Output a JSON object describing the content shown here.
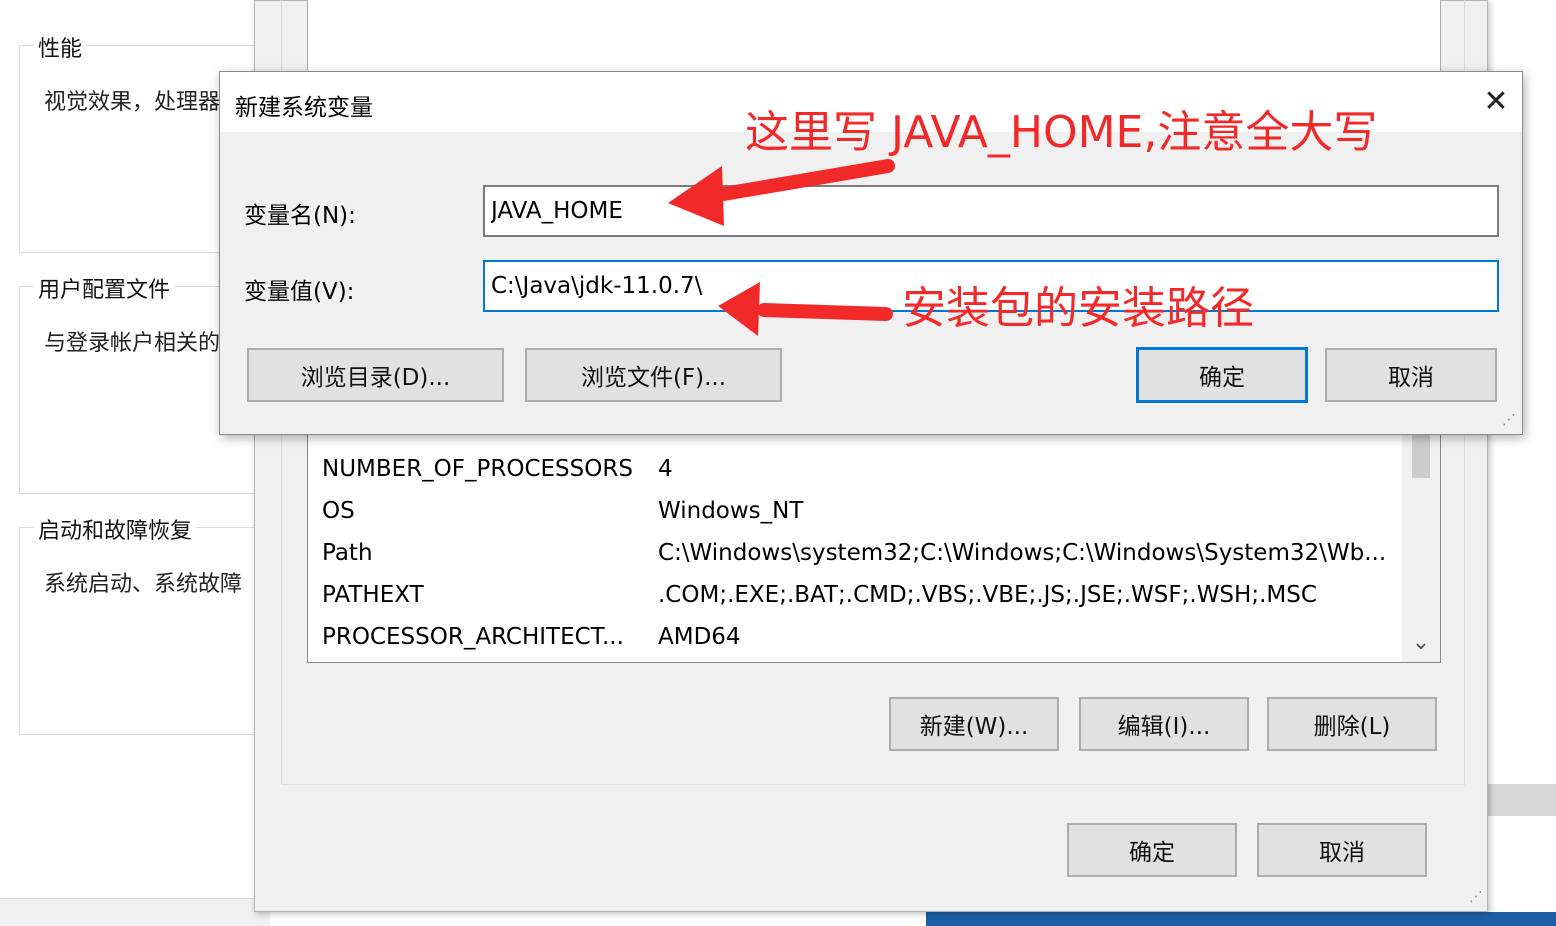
{
  "background": {
    "groups": [
      {
        "title": "性能",
        "desc": "视觉效果，处理器"
      },
      {
        "title": "用户配置文件",
        "desc": "与登录帐户相关的"
      },
      {
        "title": "启动和故障恢复",
        "desc": "系统启动、系统故障"
      }
    ]
  },
  "env_window": {
    "system_variables": [
      {
        "name": "NUMBER_OF_PROCESSORS",
        "value": "4"
      },
      {
        "name": "OS",
        "value": "Windows_NT"
      },
      {
        "name": "Path",
        "value": "C:\\Windows\\system32;C:\\Windows;C:\\Windows\\System32\\Wb..."
      },
      {
        "name": "PATHEXT",
        "value": ".COM;.EXE;.BAT;.CMD;.VBS;.VBE;.JS;.JSE;.WSF;.WSH;.MSC"
      },
      {
        "name": "PROCESSOR_ARCHITECT...",
        "value": "AMD64"
      }
    ],
    "new_label": "新建(W)...",
    "edit_label": "编辑(I)...",
    "delete_label": "删除(L)",
    "ok_label": "确定",
    "cancel_label": "取消"
  },
  "dialog": {
    "title": "新建系统变量",
    "close_glyph": "✕",
    "name_label": "变量名(N):",
    "name_value": "JAVA_HOME",
    "value_label": "变量值(V):",
    "value_value": "C:\\Java\\jdk-11.0.7\\",
    "browse_dir_label": "浏览目录(D)...",
    "browse_file_label": "浏览文件(F)...",
    "ok_label": "确定",
    "cancel_label": "取消"
  },
  "annotations": {
    "name_hint": "这里写 JAVA_HOME,注意全大写",
    "value_hint": "安装包的安装路径",
    "color": "#f22929"
  },
  "icons": {
    "scroll_down": "⌄",
    "grip": "⋰"
  }
}
